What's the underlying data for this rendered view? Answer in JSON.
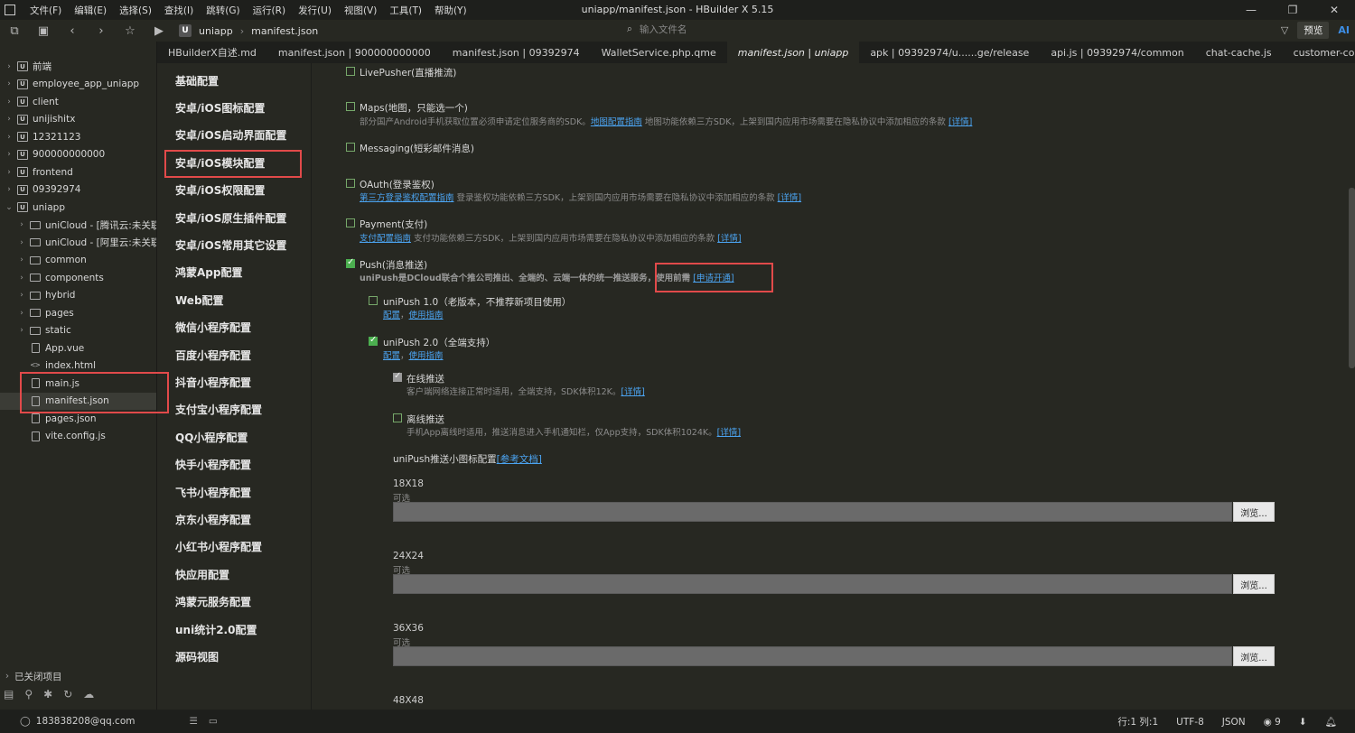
{
  "window": {
    "title": "uniapp/manifest.json - HBuilder X 5.15",
    "controls": [
      "—",
      "❐",
      "✕"
    ]
  },
  "menu": [
    "文件(F)",
    "编辑(E)",
    "选择(S)",
    "查找(I)",
    "跳转(G)",
    "运行(R)",
    "发行(U)",
    "视图(V)",
    "工具(T)",
    "帮助(Y)"
  ],
  "toolbar": {
    "crumb_project": "uniapp",
    "crumb_file": "manifest.json",
    "search_placeholder": "输入文件名",
    "preview_label": "预览",
    "ai_label": "AI"
  },
  "tabs": [
    "HBuilderX自述.md",
    "manifest.json | 900000000000",
    "manifest.json | 09392974",
    "WalletService.php.qme",
    "manifest.json | uniapp",
    "apk | 09392974/u......ge/release",
    "api.js | 09392974/common",
    "chat-cache.js",
    "customer-config.js"
  ],
  "active_tab_index": 4,
  "tree": [
    {
      "label": "前端",
      "level": 0,
      "type": "proj",
      "expanded": false
    },
    {
      "label": "employee_app_uniapp",
      "level": 0,
      "type": "proj",
      "expanded": false
    },
    {
      "label": "client",
      "level": 0,
      "type": "proj",
      "expanded": false
    },
    {
      "label": "unijishitx",
      "level": 0,
      "type": "proj",
      "expanded": false
    },
    {
      "label": "12321123",
      "level": 0,
      "type": "proj",
      "expanded": false
    },
    {
      "label": "900000000000",
      "level": 0,
      "type": "proj",
      "expanded": false
    },
    {
      "label": "frontend",
      "level": 0,
      "type": "proj",
      "expanded": false
    },
    {
      "label": "09392974",
      "level": 0,
      "type": "proj",
      "expanded": false
    },
    {
      "label": "uniapp",
      "level": 0,
      "type": "proj",
      "expanded": true
    },
    {
      "label": "uniCloud - [腾讯云:未关联云",
      "level": 1,
      "type": "folder",
      "expanded": false
    },
    {
      "label": "uniCloud - [阿里云:未关联云",
      "level": 1,
      "type": "folder",
      "expanded": false
    },
    {
      "label": "common",
      "level": 1,
      "type": "folder",
      "expanded": false
    },
    {
      "label": "components",
      "level": 1,
      "type": "folder",
      "expanded": false
    },
    {
      "label": "hybrid",
      "level": 1,
      "type": "folder",
      "expanded": false
    },
    {
      "label": "pages",
      "level": 1,
      "type": "folder",
      "expanded": false
    },
    {
      "label": "static",
      "level": 1,
      "type": "folder",
      "expanded": false
    },
    {
      "label": "App.vue",
      "level": 1,
      "type": "file"
    },
    {
      "label": "index.html",
      "level": 1,
      "type": "html"
    },
    {
      "label": "main.js",
      "level": 1,
      "type": "file"
    },
    {
      "label": "manifest.json",
      "level": 1,
      "type": "file",
      "selected": true
    },
    {
      "label": "pages.json",
      "level": 1,
      "type": "file"
    },
    {
      "label": "vite.config.js",
      "level": 1,
      "type": "file"
    }
  ],
  "closed_projects_label": "已关闭项目",
  "config_nav": [
    "基础配置",
    "安卓/iOS图标配置",
    "安卓/iOS启动界面配置",
    "安卓/iOS模块配置",
    "安卓/iOS权限配置",
    "安卓/iOS原生插件配置",
    "安卓/iOS常用其它设置",
    "鸿蒙App配置",
    "Web配置",
    "微信小程序配置",
    "百度小程序配置",
    "抖音小程序配置",
    "支付宝小程序配置",
    "QQ小程序配置",
    "快手小程序配置",
    "飞书小程序配置",
    "京东小程序配置",
    "小红书小程序配置",
    "快应用配置",
    "鸿蒙元服务配置",
    "uni统计2.0配置",
    "源码视图"
  ],
  "modules": {
    "livepusher": {
      "title": "LivePusher(直播推流)",
      "checked": false
    },
    "maps": {
      "title": "Maps(地图，只能选一个)",
      "checked": false,
      "desc": "部分国产Android手机获取位置必须申请定位服务商的SDK。",
      "link1": "地图配置指南",
      "desc2": "地图功能依赖三方SDK，上架到国内应用市场需要在隐私协议中添加相应的条款",
      "link2": "[详情]"
    },
    "messaging": {
      "title": "Messaging(短彩邮件消息)",
      "checked": false
    },
    "oauth": {
      "title": "OAuth(登录鉴权)",
      "checked": false,
      "link1": "第三方登录鉴权配置指南",
      "desc2": "登录鉴权功能依赖三方SDK，上架到国内应用市场需要在隐私协议中添加相应的条款",
      "link2": "[详情]"
    },
    "payment": {
      "title": "Payment(支付)",
      "checked": false,
      "link1": "支付配置指南",
      "desc2": "支付功能依赖三方SDK，上架到国内应用市场需要在隐私协议中添加相应的条款",
      "link2": "[详情]"
    },
    "push": {
      "title": "Push(消息推送)",
      "checked": true,
      "desc": "uniPush是DCloud联合个推公司推出、全端的、云端一体的统一推送服务，使用前需",
      "link": "[申请开通]"
    },
    "unipush1": {
      "title": "uniPush 1.0（老版本，不推荐新项目使用）",
      "checked": false,
      "link1": "配置",
      "sep": "，",
      "link2": "使用指南"
    },
    "unipush2": {
      "title": "uniPush 2.0（全端支持）",
      "checked": true,
      "link1": "配置",
      "sep": "，",
      "link2": "使用指南"
    },
    "online": {
      "title": "在线推送",
      "checked": true,
      "desc": "客户端网络连接正常时适用，全端支持，SDK体积12K。",
      "link": "[详情]"
    },
    "offline": {
      "title": "离线推送",
      "checked": false,
      "desc": "手机App离线时适用，推送消息进入手机通知栏，仅App支持，SDK体积1024K。",
      "link": "[详情]"
    }
  },
  "icon_config": {
    "title": "uniPush推送小图标配置",
    "link": "[参考文档]",
    "sizes": [
      {
        "label": "18X18",
        "sub": "可选",
        "value": ""
      },
      {
        "label": "24X24",
        "sub": "可选",
        "value": ""
      },
      {
        "label": "36X36",
        "sub": "可选",
        "value": ""
      },
      {
        "label": "48X48",
        "sub": "",
        "value": ""
      }
    ],
    "browse_label": "浏览..."
  },
  "status": {
    "account": "183838208@qq.com",
    "position": "行:1  列:1",
    "encoding": "UTF-8",
    "language": "JSON",
    "notifications": "9"
  },
  "colors": {
    "accent_link": "#4ba3f0",
    "check_green": "#4caf50",
    "highlight_red": "#e14a4a"
  }
}
